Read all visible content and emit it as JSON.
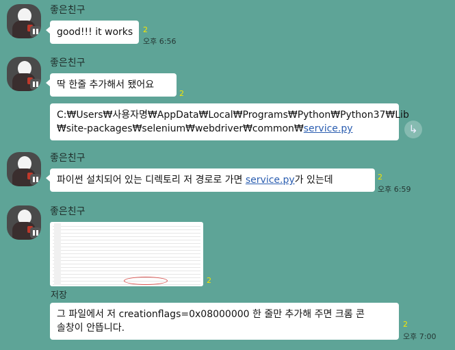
{
  "sender_name": "좋은친구",
  "messages": [
    {
      "text": "good!!!  it works",
      "unread": "2",
      "time": "오후 6:56"
    },
    {
      "text": "딱 한줄 추가해서 됐어요",
      "unread": "2"
    },
    {
      "path_line1": "C:₩Users₩사용자명₩AppData₩Local₩Programs₩Python₩Python37₩Lib",
      "path_line2_prefix": "₩site-packages₩selenium₩webdriver₩common₩",
      "path_link": "service.py"
    },
    {
      "text_prefix": "파이썬 설치되어 있는 디렉토리 저 경로로 가면 ",
      "link": "service.py",
      "text_suffix": "가 있는데",
      "unread": "2",
      "time": "오후 6:59"
    },
    {
      "image_label": "저장",
      "unread": "2"
    },
    {
      "line1": "그 파일에서 저 creationflags=0x08000000 한 줄만 추가해 주면 크롬 콘",
      "line2": "솔창이 안뜹니다.",
      "unread": "2",
      "time": "오후 7:00"
    }
  ],
  "icons": {
    "share": "share-icon"
  }
}
